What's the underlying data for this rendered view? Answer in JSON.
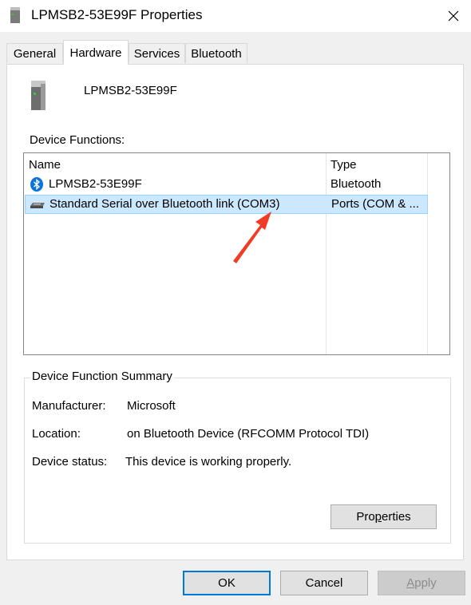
{
  "window": {
    "title": "LPMSB2-53E99F Properties"
  },
  "tabs": [
    {
      "label": "General"
    },
    {
      "label": "Hardware",
      "active": true
    },
    {
      "label": "Services"
    },
    {
      "label": "Bluetooth"
    }
  ],
  "device": {
    "name": "LPMSB2-53E99F",
    "icon": "device-tower-icon"
  },
  "functions": {
    "label": "Device Functions:",
    "columns": {
      "name": "Name",
      "type": "Type"
    },
    "rows": [
      {
        "name": "LPMSB2-53E99F",
        "type": "Bluetooth",
        "icon": "bluetooth-icon",
        "selected": false
      },
      {
        "name": "Standard Serial over Bluetooth link (COM3)",
        "type": "Ports (COM & ...",
        "icon": "serial-port-icon",
        "selected": true
      }
    ]
  },
  "summary": {
    "title": "Device Function Summary",
    "manufacturer_label": "Manufacturer:",
    "manufacturer_value": "Microsoft",
    "location_label": "Location:",
    "location_value": "on Bluetooth Device (RFCOMM Protocol TDI)",
    "status_label": "Device status:",
    "status_value": "This device is working properly.",
    "properties_button": {
      "pre": "Pro",
      "accel": "p",
      "post": "erties"
    }
  },
  "footer": {
    "ok": "OK",
    "cancel": "Cancel",
    "apply": {
      "accel": "A",
      "post": "pply"
    }
  },
  "colors": {
    "accent": "#0078d7",
    "selection": "#cce8ff",
    "annotation_arrow": "#f03c24"
  }
}
